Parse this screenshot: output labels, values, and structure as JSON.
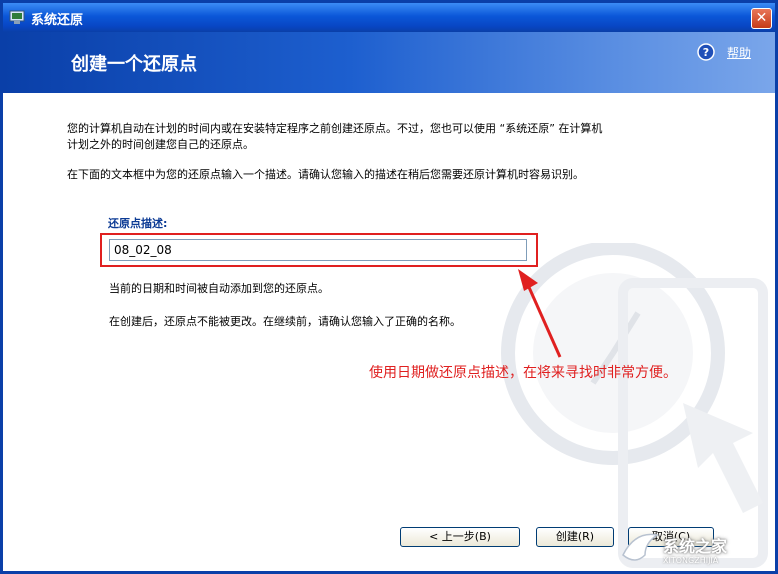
{
  "window": {
    "title": "系统还原",
    "close_label": "✕"
  },
  "header": {
    "title": "创建一个还原点",
    "help_label": "帮助"
  },
  "body": {
    "para1": "您的计算机自动在计划的时间内或在安装特定程序之前创建还原点。不过，您也可以使用 “系统还原” 在计算机计划之外的时间创建您自己的还原点。",
    "para2": "在下面的文本框中为您的还原点输入一个描述。请确认您输入的描述在稍后您需要还原计算机时容易识别。",
    "field_label": "还原点描述:",
    "field_value": "08_02_08",
    "note1": "当前的日期和时间被自动添加到您的还原点。",
    "note2": "在创建后，还原点不能被更改。在继续前，请确认您输入了正确的名称。"
  },
  "annotation": {
    "text": "使用日期做还原点描述，在将来寻找时非常方便。"
  },
  "buttons": {
    "back": "< 上一步(B)",
    "create": "创建(R)",
    "cancel": "取消(C)"
  },
  "watermark": {
    "text": "系统之家",
    "sub": "XITONGZHIJIA"
  },
  "colors": {
    "title_bar": "#0b57d8",
    "annotation": "#e02020",
    "label": "#0b3a94"
  }
}
